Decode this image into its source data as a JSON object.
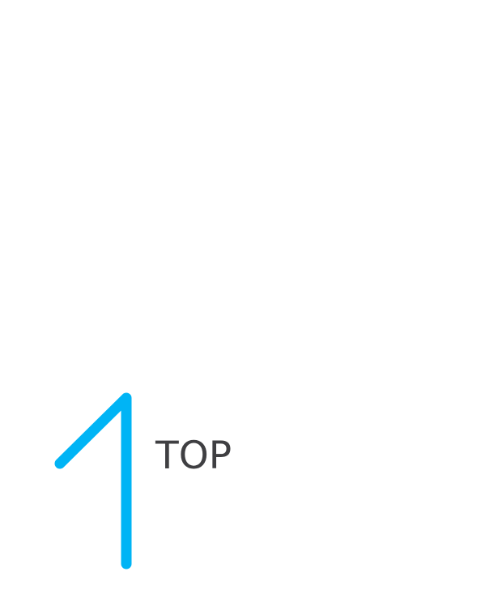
{
  "back_to_top": {
    "label": "TOP",
    "icon": "arrow-up-icon",
    "icon_color": "#00b4f5",
    "label_color": "#3f3f42"
  },
  "page": {
    "background": "#ffffff"
  }
}
